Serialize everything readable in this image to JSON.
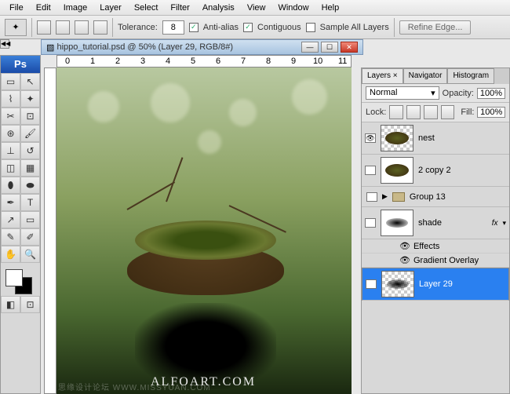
{
  "menu": [
    "File",
    "Edit",
    "Image",
    "Layer",
    "Select",
    "Filter",
    "Analysis",
    "View",
    "Window",
    "Help"
  ],
  "options": {
    "tolerance_label": "Tolerance:",
    "tolerance_value": "8",
    "antialias": "Anti-alias",
    "contiguous": "Contiguous",
    "sample_all": "Sample All Layers",
    "refine": "Refine Edge..."
  },
  "doc": {
    "title": "hippo_tutorial.psd @ 50% (Layer 29, RGB/8#)"
  },
  "ruler": [
    "0",
    "1",
    "2",
    "3",
    "4",
    "5",
    "6",
    "7",
    "8",
    "9",
    "10",
    "11"
  ],
  "watermark": "ALFOART.COM",
  "watermark2": "思缘设计论坛  WWW.MISSYUAN.COM",
  "panel": {
    "tabs": [
      "Layers ×",
      "Navigator",
      "Histogram"
    ],
    "blend": "Normal",
    "opacity_label": "Opacity:",
    "opacity": "100%",
    "lock_label": "Lock:",
    "fill_label": "Fill:",
    "fill": "100%",
    "layers": [
      {
        "name": "nest"
      },
      {
        "name": "2 copy 2"
      },
      {
        "name": "Group 13"
      },
      {
        "name": "shade"
      },
      {
        "name": "Layer 29"
      }
    ],
    "effects": "Effects",
    "grad": "Gradient Overlay",
    "fx": "fx"
  }
}
